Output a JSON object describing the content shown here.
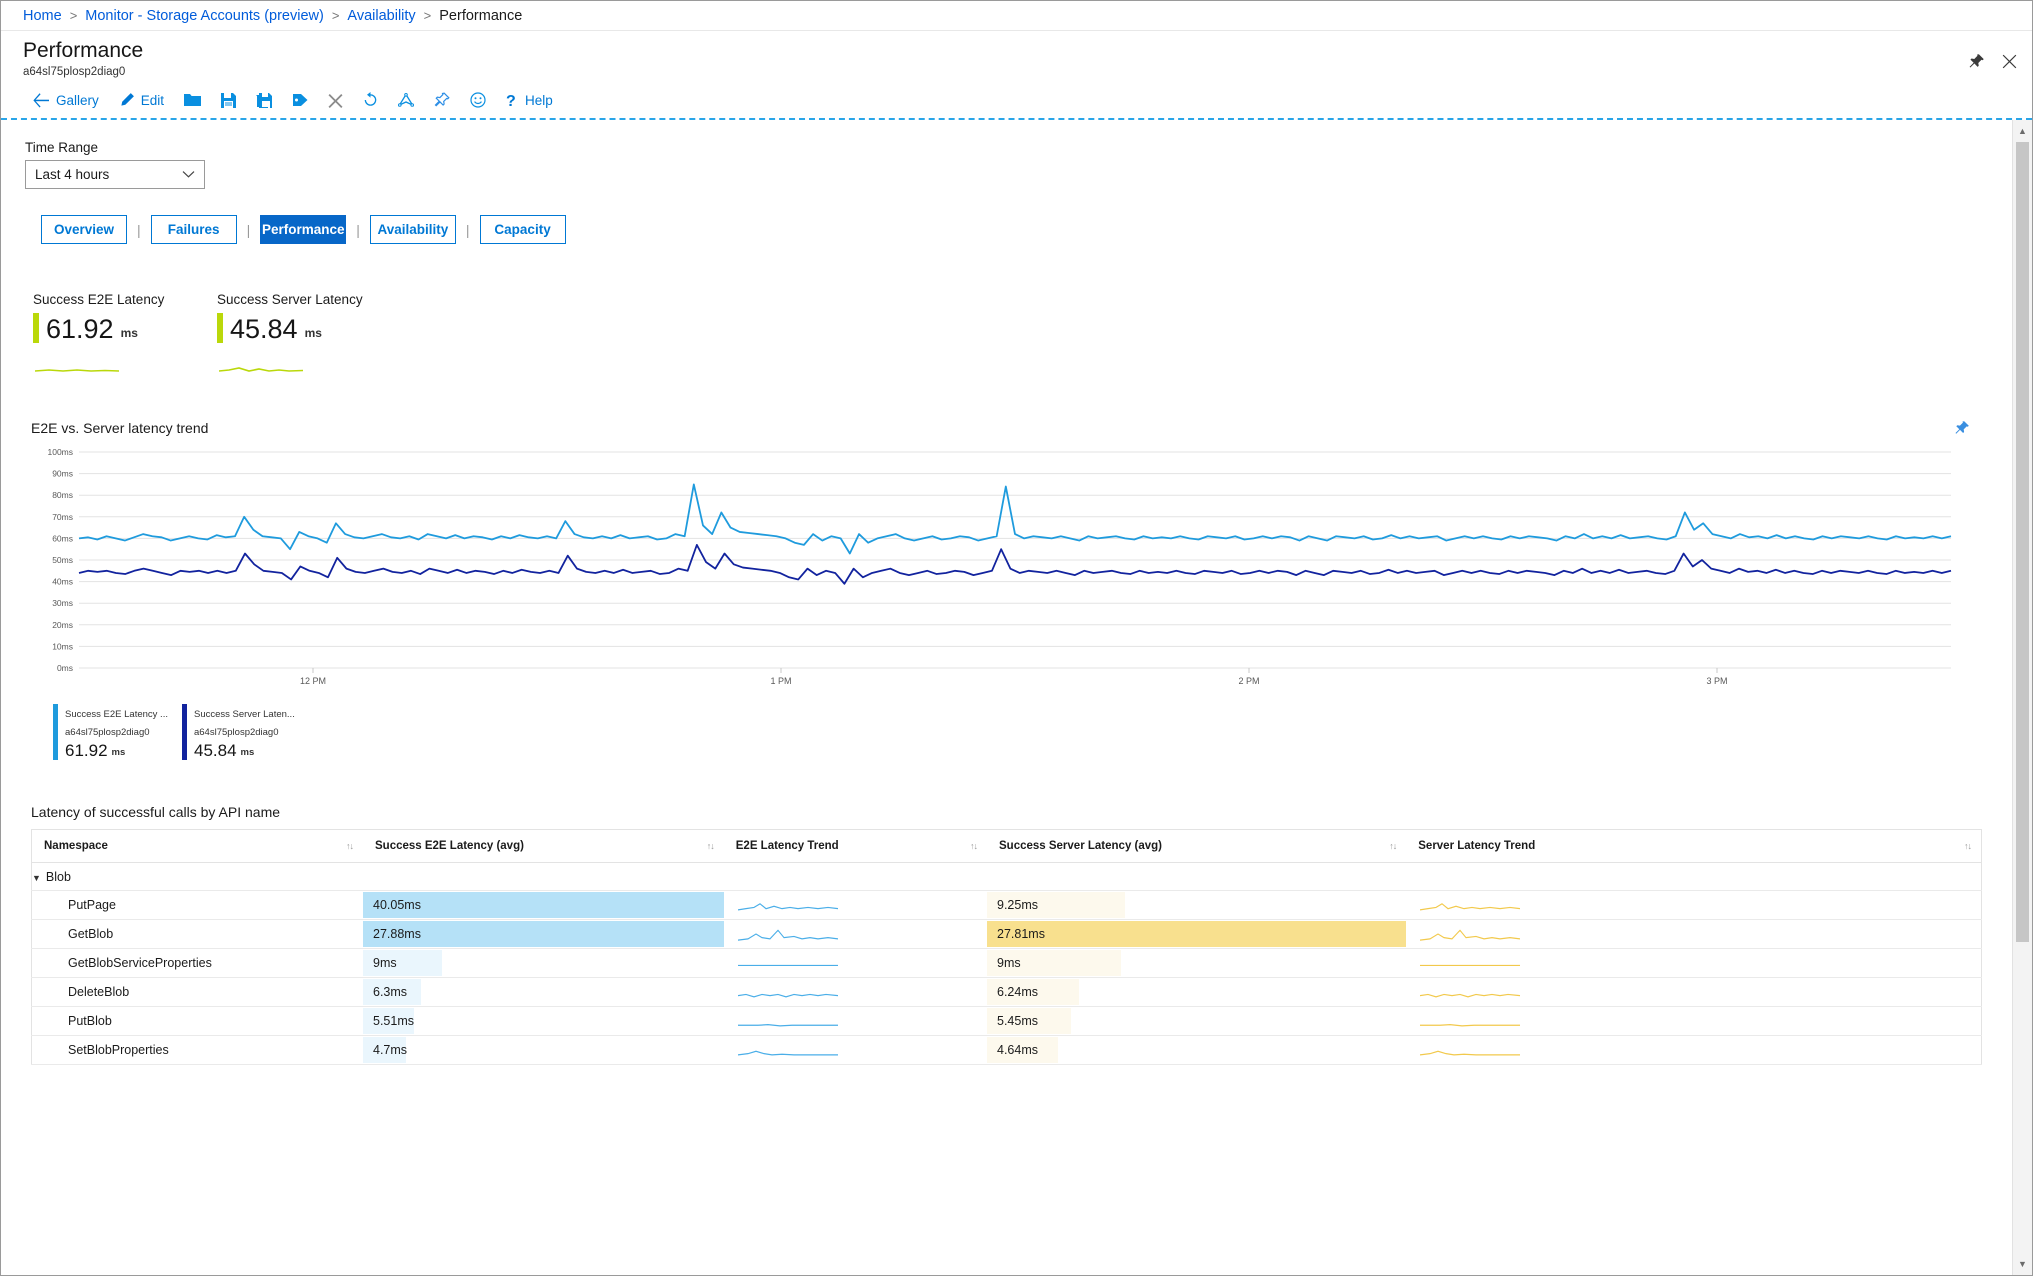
{
  "breadcrumb": {
    "items": [
      {
        "label": "Home",
        "link": true
      },
      {
        "label": "Monitor - Storage Accounts (preview)",
        "link": true
      },
      {
        "label": "Availability",
        "link": true
      },
      {
        "label": "Performance",
        "link": false
      }
    ],
    "separator": ">"
  },
  "header": {
    "title": "Performance",
    "subtitle": "a64sl75plosp2diag0",
    "pin_icon": "pin-icon",
    "close_icon": "close-icon"
  },
  "toolbar": {
    "items": [
      {
        "label": "Gallery",
        "icon": "back-arrow-icon"
      },
      {
        "label": "Edit",
        "icon": "pencil-icon"
      },
      {
        "label": "",
        "icon": "folder-icon"
      },
      {
        "label": "",
        "icon": "save-icon"
      },
      {
        "label": "",
        "icon": "save-as-icon"
      },
      {
        "label": "",
        "icon": "tag-icon"
      },
      {
        "label": "",
        "icon": "close-x-icon"
      },
      {
        "label": "",
        "icon": "refresh-icon"
      },
      {
        "label": "",
        "icon": "share-icon"
      },
      {
        "label": "",
        "icon": "pin-icon"
      },
      {
        "label": "",
        "icon": "smiley-icon"
      },
      {
        "label": "Help",
        "icon": "question-icon"
      }
    ]
  },
  "time_range": {
    "label": "Time Range",
    "value": "Last 4 hours",
    "chevron_icon": "chevron-down-icon"
  },
  "tabs": [
    {
      "label": "Overview",
      "active": false
    },
    {
      "label": "Failures",
      "active": false
    },
    {
      "label": "Performance",
      "active": true
    },
    {
      "label": "Availability",
      "active": false
    },
    {
      "label": "Capacity",
      "active": false
    }
  ],
  "tab_divider": "|",
  "kpis": [
    {
      "title": "Success E2E Latency",
      "value": "61.92",
      "unit": "ms",
      "accent": "#bad80a"
    },
    {
      "title": "Success Server Latency",
      "value": "45.84",
      "unit": "ms",
      "accent": "#bad80a"
    }
  ],
  "chart": {
    "title": "E2E vs. Server latency trend",
    "pin_icon": "pin-icon",
    "legend": [
      {
        "line1": "Success E2E Latency ...",
        "line2": "a64sl75plosp2diag0",
        "value": "61.92",
        "unit": "ms",
        "color": "#1f9bdd"
      },
      {
        "line1": "Success Server Laten...",
        "line2": "a64sl75plosp2diag0",
        "value": "45.84",
        "unit": "ms",
        "color": "#12239e"
      }
    ]
  },
  "chart_data": {
    "type": "line",
    "title": "E2E vs. Server latency trend",
    "xlabel": "",
    "ylabel": "",
    "ylim": [
      0,
      100
    ],
    "yticks": [
      "0ms",
      "10ms",
      "20ms",
      "30ms",
      "40ms",
      "50ms",
      "60ms",
      "70ms",
      "80ms",
      "90ms",
      "100ms"
    ],
    "xticks": [
      "12 PM",
      "1 PM",
      "2 PM",
      "3 PM"
    ],
    "grid": true,
    "legend_position": "bottom-left",
    "series": [
      {
        "name": "Success E2E Latency - a64sl75plosp2diag0",
        "color": "#1f9bdd",
        "unit": "ms",
        "current": 61.92,
        "values": [
          60,
          60.5,
          59.5,
          61,
          60,
          59,
          60.5,
          62,
          61,
          60.5,
          59,
          60,
          61,
          60,
          59.5,
          61.5,
          60.5,
          61,
          70,
          64,
          61,
          60.5,
          60,
          55,
          63,
          61,
          60,
          58,
          67,
          62,
          60.5,
          60,
          61,
          62,
          60.5,
          60,
          61,
          59.5,
          62,
          61,
          60,
          61.5,
          60,
          61,
          60.5,
          59.5,
          61,
          60,
          61.5,
          60.5,
          60,
          61,
          60,
          68,
          62,
          60.5,
          60,
          61,
          60,
          61.5,
          60,
          60.5,
          61,
          59.5,
          60,
          62,
          61,
          85,
          66,
          62,
          72,
          65,
          63,
          62.5,
          62,
          61.5,
          61,
          60,
          58,
          57,
          62,
          59,
          61,
          60,
          53,
          62,
          58,
          60,
          61,
          62,
          60,
          59,
          60,
          61,
          59.5,
          60,
          61,
          60.5,
          59,
          60,
          61,
          84,
          62,
          60,
          61,
          60.5,
          60,
          61,
          60,
          59,
          61,
          60,
          60.5,
          61,
          60,
          59.5,
          61,
          60,
          60.5,
          60,
          61,
          60,
          59.5,
          61,
          60.5,
          60,
          61,
          59.5,
          60,
          61,
          60,
          61,
          60.5,
          59,
          61,
          60,
          59,
          61,
          60.5,
          60,
          61,
          59.5,
          60,
          61.5,
          60,
          61,
          60,
          60.5,
          61,
          59,
          60,
          61,
          60,
          61,
          60,
          59.5,
          61,
          60,
          61,
          60.5,
          60,
          59,
          61,
          60,
          62,
          60,
          61,
          60,
          61.5,
          60,
          60.5,
          61,
          60,
          59.5,
          61,
          72,
          64,
          67,
          62,
          61,
          60,
          62,
          60.5,
          61,
          60,
          61.5,
          60,
          61,
          60,
          59.5,
          61,
          60,
          61,
          60.5,
          60,
          61,
          60,
          59.5,
          61,
          60,
          60.5,
          60,
          61,
          60,
          61
        ]
      },
      {
        "name": "Success Server Latency - a64sl75plosp2diag0",
        "color": "#12239e",
        "unit": "ms",
        "current": 45.84,
        "values": [
          44,
          45,
          44.5,
          45,
          44,
          43.5,
          45,
          46,
          45,
          44,
          43,
          45,
          44.5,
          45,
          44,
          45,
          44,
          45,
          53,
          48,
          45,
          44.5,
          44,
          41,
          47,
          45,
          44,
          42,
          51,
          46,
          44.5,
          44,
          45,
          46,
          44.5,
          44,
          45,
          43.5,
          46,
          45,
          44,
          45.5,
          44,
          45,
          44.5,
          43.5,
          45,
          44,
          45.5,
          44.5,
          44,
          45,
          44,
          52,
          46,
          44.5,
          44,
          45,
          44,
          45.5,
          44,
          44.5,
          45,
          43.5,
          44,
          46,
          45,
          57,
          49,
          46,
          53,
          48,
          46.5,
          46,
          45.5,
          45,
          44,
          42,
          41,
          46,
          43,
          45,
          44,
          39,
          46,
          42,
          44,
          45,
          46,
          44,
          43,
          44,
          45,
          43.5,
          44,
          45,
          44.5,
          43,
          44,
          45,
          55,
          46,
          44,
          45,
          44.5,
          44,
          45,
          44,
          43,
          45,
          44,
          44.5,
          45,
          44,
          43.5,
          45,
          44,
          44.5,
          44,
          45,
          44,
          43.5,
          45,
          44.5,
          44,
          45,
          43.5,
          44,
          45,
          44,
          45,
          44.5,
          43,
          45,
          44,
          43,
          45,
          44.5,
          44,
          45,
          43.5,
          44,
          45.5,
          44,
          45,
          44,
          44.5,
          45,
          43,
          44,
          45,
          44,
          45,
          44,
          43.5,
          45,
          44,
          45,
          44.5,
          44,
          43,
          45,
          44,
          46,
          44,
          45,
          44,
          45.5,
          44,
          44.5,
          45,
          44,
          43.5,
          45,
          53,
          47,
          50,
          46,
          45,
          44,
          46,
          44.5,
          45,
          44,
          45.5,
          44,
          45,
          44,
          43.5,
          45,
          44,
          45,
          44.5,
          44,
          45,
          44,
          43.5,
          45,
          44,
          44.5,
          44,
          45,
          44,
          45
        ]
      }
    ]
  },
  "table": {
    "title": "Latency of successful calls by API name",
    "sort_icon": "sort-icon",
    "columns": [
      {
        "label": "Namespace",
        "sortable": true
      },
      {
        "label": "Success E2E Latency (avg)",
        "sortable": true
      },
      {
        "label": "E2E Latency Trend",
        "sortable": true
      },
      {
        "label": "Success Server Latency (avg)",
        "sortable": true
      },
      {
        "label": "Server Latency Trend",
        "sortable": true
      }
    ],
    "group": {
      "label": "Blob",
      "caret": "▼",
      "expanded": true
    },
    "bar_color_e2e": "#b5e1f7",
    "bar_color_server": "#f8e08e",
    "spark_color_e2e": "#4aaee8",
    "spark_color_server": "#f2c94c",
    "rows": [
      {
        "namespace": "PutPage",
        "e2e": "40.05ms",
        "e2e_pct": 100,
        "server": "9.25ms",
        "server_pct": 33
      },
      {
        "namespace": "GetBlob",
        "e2e": "27.88ms",
        "e2e_pct": 100,
        "server": "27.81ms",
        "server_pct": 100
      },
      {
        "namespace": "GetBlobServiceProperties",
        "e2e": "9ms",
        "e2e_pct": 22,
        "server": "9ms",
        "server_pct": 32
      },
      {
        "namespace": "DeleteBlob",
        "e2e": "6.3ms",
        "e2e_pct": 16,
        "server": "6.24ms",
        "server_pct": 22
      },
      {
        "namespace": "PutBlob",
        "e2e": "5.51ms",
        "e2e_pct": 14,
        "server": "5.45ms",
        "server_pct": 20
      },
      {
        "namespace": "SetBlobProperties",
        "e2e": "4.7ms",
        "e2e_pct": 12,
        "server": "4.64ms",
        "server_pct": 17
      }
    ]
  },
  "scrollbar": {
    "up_arrow": "▲",
    "down_arrow": "▼"
  }
}
